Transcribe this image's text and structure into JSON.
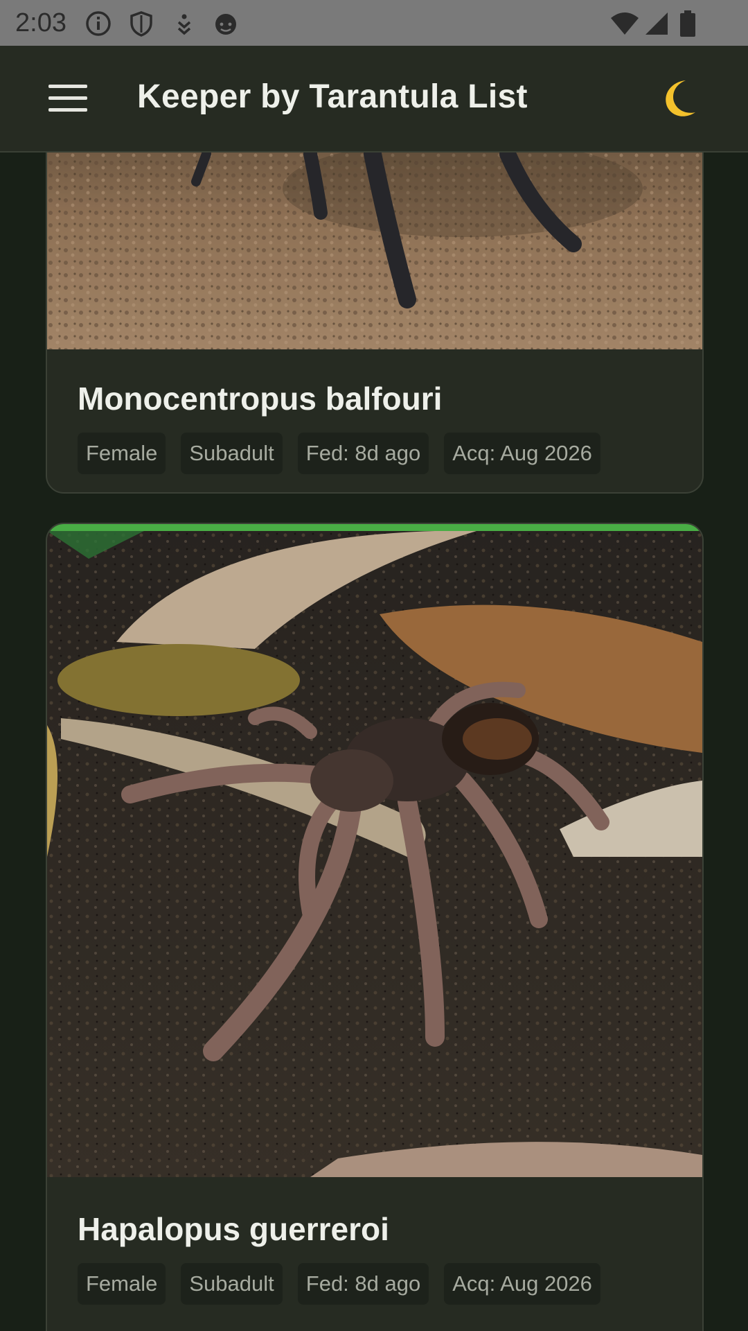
{
  "status_bar": {
    "time": "2:03",
    "icons": [
      "info-icon",
      "shield-icon",
      "download-icon",
      "face-icon"
    ],
    "right_icons": [
      "wifi-icon",
      "signal-icon",
      "battery-icon"
    ]
  },
  "app_bar": {
    "title": "Keeper by Tarantula List",
    "menu_icon": "hamburger-menu-icon",
    "theme_icon": "crescent-moon-icon",
    "theme_icon_glyph": "🌙"
  },
  "cards": [
    {
      "name": "Monocentropus balfouri",
      "chips": [
        "Female",
        "Subadult",
        "Fed: 8d ago",
        "Acq: Aug 2026"
      ]
    },
    {
      "name": "Hapalopus guerreroi",
      "accent_color": "#49ad45",
      "chips": [
        "Female",
        "Subadult",
        "Fed: 8d ago",
        "Acq: Aug 2026"
      ]
    }
  ]
}
